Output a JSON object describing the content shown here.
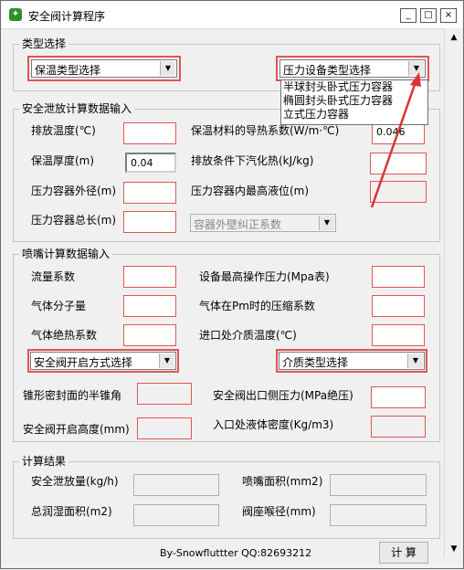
{
  "window": {
    "title": "安全阀计算程序",
    "min_label": "_",
    "max_label": "□",
    "close_label": "×"
  },
  "type_section": {
    "title": "类型选择",
    "insulation_combo": "保温类型选择",
    "vessel_combo": "压力设备类型选择",
    "vessel_options": [
      "半球封头卧式压力容器",
      "椭圆封头卧式压力容器",
      "立式压力容器"
    ]
  },
  "relief_section": {
    "title": "安全泄放计算数据输入",
    "discharge_temp_label": "排放温度(℃)",
    "thermal_cond_label": "保温材料的导热系数(W/m·℃)",
    "thermal_cond_value": "0.046",
    "insul_thickness_label": "保温厚度(m)",
    "insul_thickness_value": "0.04",
    "latent_heat_label": "排放条件下汽化热(kJ/kg)",
    "vessel_od_label": "压力容器外径(m)",
    "max_level_label": "压力容器内最高液位(m)",
    "vessel_length_label": "压力容器总长(m)",
    "correction_combo": "容器外壁纠正系数"
  },
  "nozzle_section": {
    "title": "喷嘴计算数据输入",
    "flow_coef_label": "流量系数",
    "max_pressure_label": "设备最高操作压力(Mpa表)",
    "mol_weight_label": "气体分子量",
    "compress_label": "气体在Pm时的压缩系数",
    "adiabatic_label": "气体绝热系数",
    "inlet_temp_label": "进口处介质温度(℃)",
    "open_mode_combo": "安全阀开启方式选择",
    "medium_combo": "介质类型选择",
    "cone_angle_label": "锥形密封面的半锥角",
    "outlet_pressure_label": "安全阀出口侧压力(MPa绝压)",
    "open_height_label": "安全阀开启高度(mm)",
    "liquid_density_label": "入口处液体密度(Kg/m3)"
  },
  "result_section": {
    "title": "计算结果",
    "relief_amount_label": "安全泄放量(kg/h)",
    "nozzle_area_label": "喷嘴面积(mm2)",
    "wetted_area_label": "总润湿面积(m2)",
    "throat_label": "阀座喉径(mm)"
  },
  "footer": {
    "credit": "By-Snowfluttter  QQ:82693212",
    "calc_button": "计 算"
  },
  "colors": {
    "highlight_red": "#e05555",
    "arrow_red": "#d93535"
  }
}
